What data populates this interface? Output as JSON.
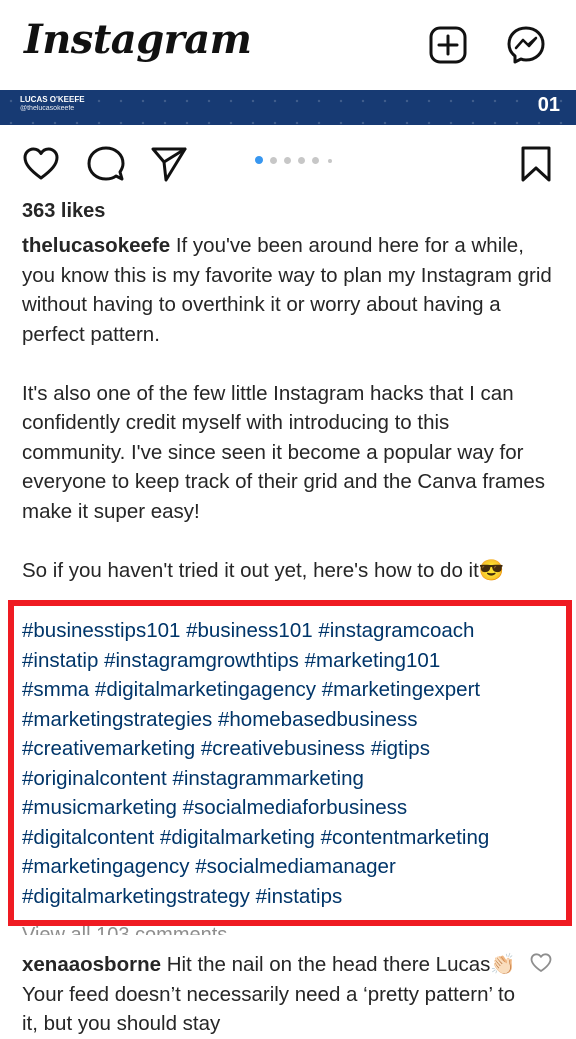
{
  "header": {
    "logo": "Instagram",
    "new_post_icon": "plus-square-icon",
    "messenger_icon": "messenger-icon"
  },
  "post_image": {
    "author_name": "LUCAS O'KEEFE",
    "author_handle": "@thelucasokeefe",
    "slide_number": "01",
    "banner_color": "#173a73"
  },
  "actions": {
    "like_icon": "heart-icon",
    "comment_icon": "comment-icon",
    "share_icon": "send-icon",
    "save_icon": "bookmark-icon",
    "carousel_active_index": 0,
    "carousel_dot_count": 6
  },
  "likes": "363 likes",
  "caption": {
    "username": "thelucasokeefe",
    "paragraph1": "If you've been around here for a while, you know this is my favorite way to plan my Instagram grid without having to overthink it or worry about having a perfect pattern.",
    "paragraph2": "It's also one of the few little Instagram hacks that I can confidently credit myself with introducing to this community. I've since seen it become a popular way for everyone to keep track of their grid and the Canva frames make it super easy!",
    "paragraph3": "So if you haven't tried it out yet, here's how to do it😎"
  },
  "hashtags": [
    "#businesstips101",
    "#business101",
    "#instagramcoach",
    "#instatip",
    "#instagramgrowthtips",
    "#marketing101",
    "#smma",
    "#digitalmarketingagency",
    "#marketingexpert",
    "#marketingstrategies",
    "#homebasedbusiness",
    "#creativemarketing",
    "#creativebusiness",
    "#igtips",
    "#originalcontent",
    "#instagrammarketing",
    "#musicmarketing",
    "#socialmediaforbusiness",
    "#digitalcontent",
    "#digitalmarketing",
    "#contentmarketing",
    "#marketingagency",
    "#socialmediamanager",
    "#digitalmarketingstrategy",
    "#instatips"
  ],
  "view_all_comments": "View all 103 comments",
  "comment": {
    "username": "xenaaosborne",
    "text": "Hit the nail on the head there Lucas👏🏻 Your feed doesn’t necessarily need a ‘pretty pattern’ to it, but you should stay"
  },
  "colors": {
    "highlight_border": "#ef1b22",
    "hashtag": "#003569",
    "carousel_active": "#3897f0"
  }
}
